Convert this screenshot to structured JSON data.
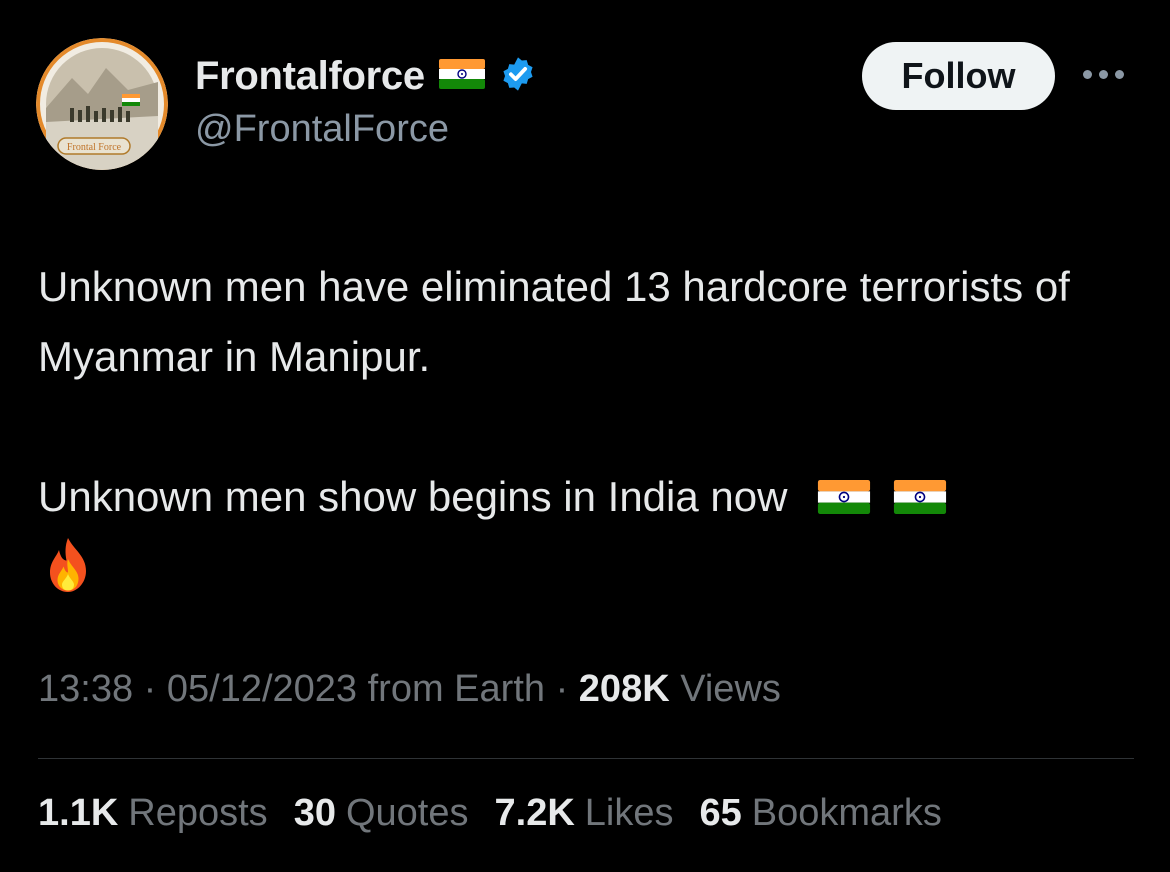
{
  "author": {
    "display_name": "Frontalforce",
    "handle": "@FrontalForce",
    "verified": true,
    "avatar_badge_text": "Frontal Force"
  },
  "header": {
    "follow_label": "Follow"
  },
  "tweet": {
    "line1": "Unknown men have eliminated 13 hardcore terrorists of Myanmar in Manipur.",
    "line2": "Unknown men show begins in India now"
  },
  "meta": {
    "time": "13:38",
    "date": "05/12/2023",
    "source": "from Earth",
    "views_count": "208K",
    "views_label": "Views"
  },
  "stats": {
    "reposts_count": "1.1K",
    "reposts_label": "Reposts",
    "quotes_count": "30",
    "quotes_label": "Quotes",
    "likes_count": "7.2K",
    "likes_label": "Likes",
    "bookmarks_count": "65",
    "bookmarks_label": "Bookmarks"
  },
  "colors": {
    "background": "#000000",
    "primary_text": "#e7e9ea",
    "secondary_text": "#71767b",
    "verified_blue": "#1d9bf0",
    "follow_bg": "#eff3f4",
    "saffron": "#ff9933",
    "india_green": "#138808",
    "chakra_navy": "#000080"
  },
  "icons": [
    "avatar-image",
    "india-flag-icon",
    "verified-badge-icon",
    "more-options-icon",
    "fire-icon"
  ]
}
